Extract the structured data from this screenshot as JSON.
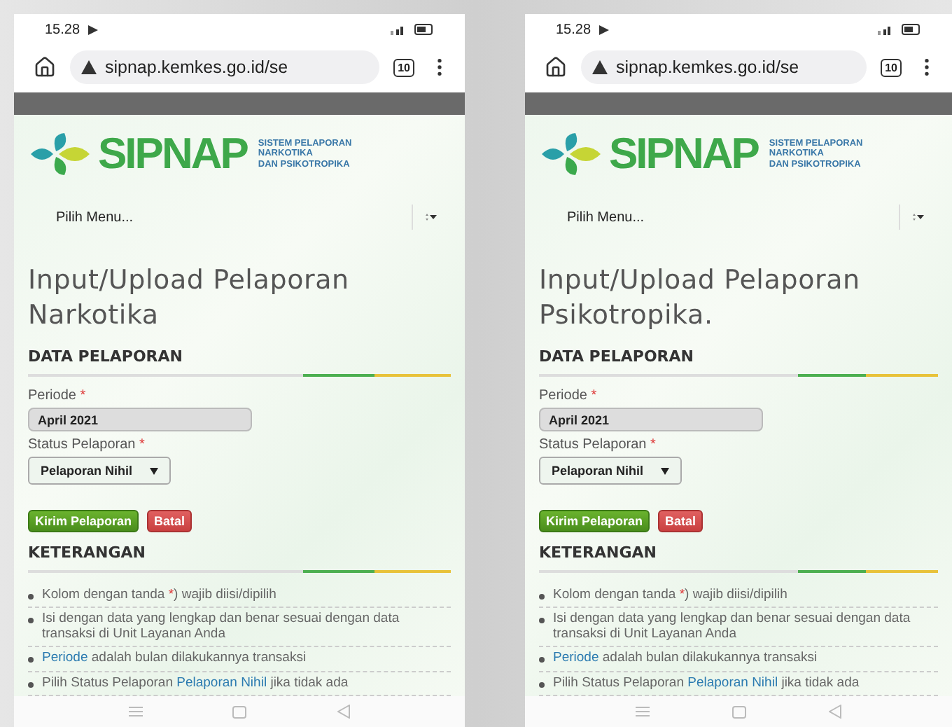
{
  "phones": [
    {
      "status": {
        "time": "15.28"
      },
      "browser": {
        "url": "sipnap.kemkes.go.id/se",
        "tab_count": "10"
      },
      "logo": {
        "name": "SIPNAP",
        "tagline": [
          "SISTEM PELAPORAN",
          "NARKOTIKA",
          "DAN PSIKOTROPIKA"
        ]
      },
      "menu": {
        "label": "Pilih Menu..."
      },
      "page_title": "Input/Upload Pelaporan Narkotika",
      "section_title": "DATA PELAPORAN",
      "fields": [
        {
          "kind": "input",
          "label": "Periode",
          "required_mark": "*",
          "value": "April 2021"
        },
        {
          "kind": "select",
          "label": "Status Pelaporan",
          "required_mark": "*",
          "value": "Pelaporan Nihil"
        }
      ],
      "buttons": [
        {
          "kind": "submit",
          "label": "Kirim Pelaporan"
        },
        {
          "kind": "cancel",
          "label": "Batal"
        }
      ],
      "notes_title": "KETERANGAN",
      "notes": [
        [
          {
            "kind": "plain",
            "text": "Kolom dengan tanda "
          },
          {
            "kind": "mark",
            "text": "*"
          },
          {
            "kind": "plain",
            "text": ") wajib diisi/dipilih"
          }
        ],
        [
          {
            "kind": "plain",
            "text": "Isi dengan data yang lengkap dan benar sesuai dengan data transaksi di Unit Layanan Anda"
          }
        ],
        [
          {
            "kind": "link",
            "text": "Periode"
          },
          {
            "kind": "plain",
            "text": " adalah bulan dilakukannya transaksi"
          }
        ],
        [
          {
            "kind": "plain",
            "text": "Pilih Status Pelaporan "
          },
          {
            "kind": "link",
            "text": "Pelaporan Nihil"
          },
          {
            "kind": "plain",
            "text": " jika tidak ada"
          }
        ]
      ]
    },
    {
      "status": {
        "time": "15.28"
      },
      "browser": {
        "url": "sipnap.kemkes.go.id/se",
        "tab_count": "10"
      },
      "logo": {
        "name": "SIPNAP",
        "tagline": [
          "SISTEM PELAPORAN",
          "NARKOTIKA",
          "DAN PSIKOTROPIKA"
        ]
      },
      "menu": {
        "label": "Pilih Menu..."
      },
      "page_title": "Input/Upload Pelaporan Psikotropika.",
      "section_title": "DATA PELAPORAN",
      "fields": [
        {
          "kind": "input",
          "label": "Periode",
          "required_mark": "*",
          "value": "April 2021"
        },
        {
          "kind": "select",
          "label": "Status Pelaporan",
          "required_mark": "*",
          "value": "Pelaporan Nihil"
        }
      ],
      "buttons": [
        {
          "kind": "submit",
          "label": "Kirim Pelaporan"
        },
        {
          "kind": "cancel",
          "label": "Batal"
        }
      ],
      "notes_title": "KETERANGAN",
      "notes": [
        [
          {
            "kind": "plain",
            "text": "Kolom dengan tanda "
          },
          {
            "kind": "mark",
            "text": "*"
          },
          {
            "kind": "plain",
            "text": ") wajib diisi/dipilih"
          }
        ],
        [
          {
            "kind": "plain",
            "text": "Isi dengan data yang lengkap dan benar sesuai dengan data transaksi di Unit Layanan Anda"
          }
        ],
        [
          {
            "kind": "link",
            "text": "Periode"
          },
          {
            "kind": "plain",
            "text": " adalah bulan dilakukannya transaksi"
          }
        ],
        [
          {
            "kind": "plain",
            "text": "Pilih Status Pelaporan "
          },
          {
            "kind": "link",
            "text": "Pelaporan Nihil"
          },
          {
            "kind": "plain",
            "text": " jika tidak ada"
          }
        ]
      ]
    }
  ]
}
